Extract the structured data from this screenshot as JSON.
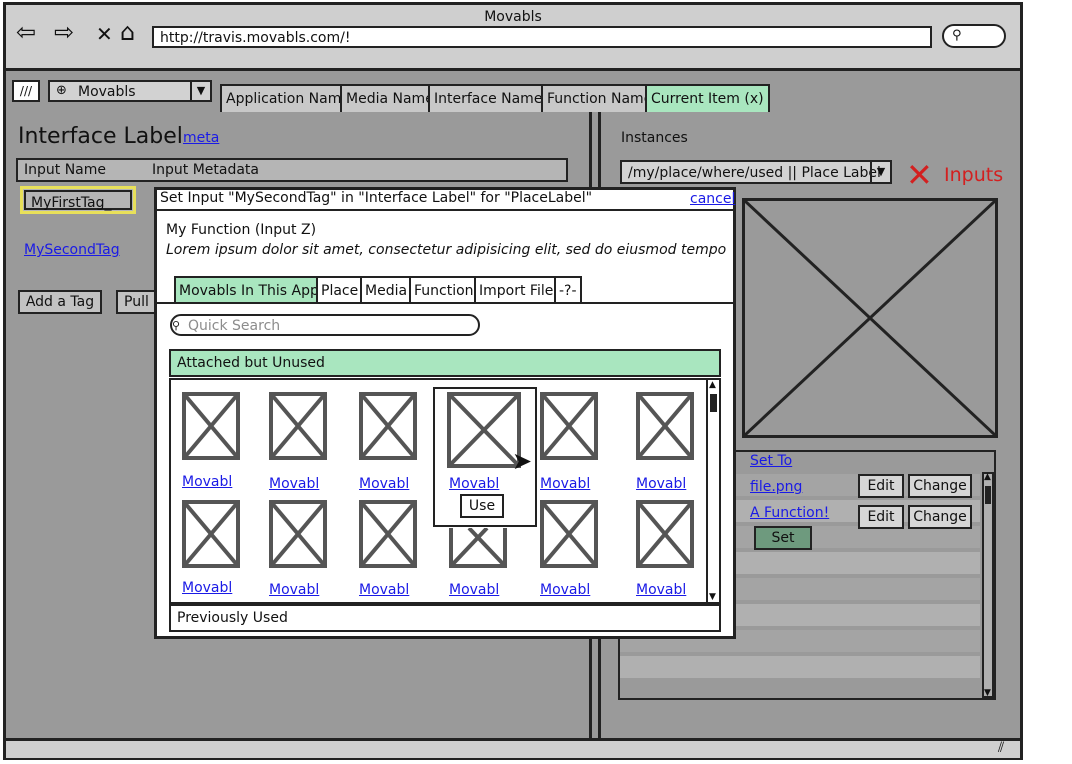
{
  "browser": {
    "window_title": "Movabls",
    "url": "http://travis.movabls.com/!",
    "nav_icons": [
      "back-arrow-icon",
      "forward-arrow-icon",
      "close-x-icon",
      "home-icon"
    ]
  },
  "appbar": {
    "app_select": "Movabls",
    "tabs": [
      "Application Name",
      "Media Name",
      "Interface Name",
      "Function Name",
      "Current Item (x)"
    ]
  },
  "left": {
    "title": "Interface Label",
    "meta_link": "meta",
    "columns": [
      "Input Name",
      "Input Metadata"
    ],
    "tag1": "MyFirstTag_",
    "tag2": "MySecondTag",
    "add_tag": "Add a Tag",
    "pull": "Pull"
  },
  "right": {
    "instances_label": "Instances",
    "instance_select": "/my/place/where/used || Place Label",
    "inputs_label": "Inputs",
    "set_to": "Set To",
    "file_link": "file.png",
    "function_link": "A Function!",
    "edit_label": "Edit",
    "change_label": "Change",
    "set_label": "Set"
  },
  "dialog": {
    "title": "Set Input \"MySecondTag\" in \"Interface Label\" for \"PlaceLabel\"",
    "cancel": "cancel",
    "function_name": "My Function (Input Z)",
    "function_desc": "Lorem ipsum dolor sit amet, consectetur adipisicing elit, sed do eiusmod tempo",
    "tabs": [
      "Movabls In This App",
      "Place",
      "Media",
      "Function",
      "Import File",
      "-?-"
    ],
    "search_placeholder": "Quick Search",
    "section_attached": "Attached but Unused",
    "section_previous": "Previously Used",
    "movabl_label": "Movabl",
    "use_label": "Use"
  },
  "colors": {
    "active_tab": "#a9e6bf",
    "panel_bg": "#9a9a9a",
    "link": "#1a1ae6",
    "error": "#d32020",
    "set_button": "#6e9a7e"
  }
}
